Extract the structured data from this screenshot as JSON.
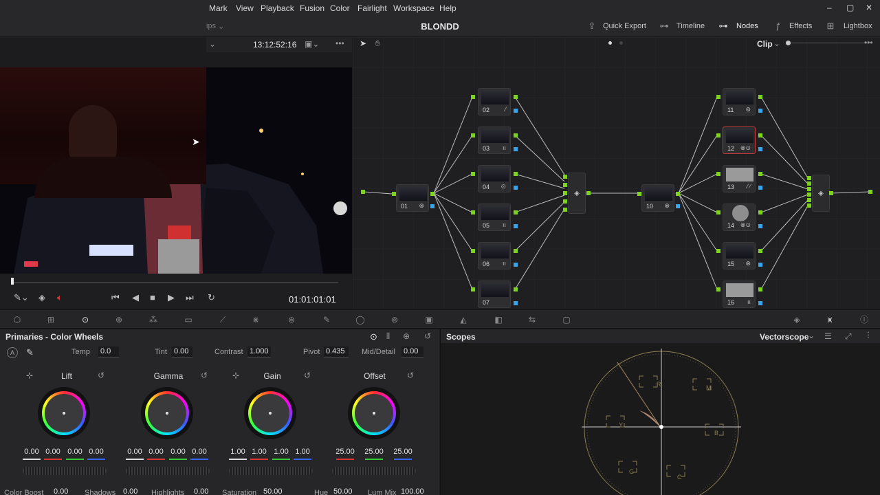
{
  "menu": {
    "items": [
      "Mark",
      "View",
      "Playback",
      "Fusion",
      "Color",
      "Fairlight",
      "Workspace",
      "Help"
    ]
  },
  "window": {
    "minimize": "–",
    "maximize": "▢",
    "close": "✕"
  },
  "toolbar": {
    "clips_partial": "ips",
    "project_title": "BLONDD",
    "quick_export": "Quick Export",
    "timeline": "Timeline",
    "nodes": "Nodes",
    "effects": "Effects",
    "lightbox": "Lightbox"
  },
  "viewer": {
    "timecode_top": "13:12:52:16",
    "timecode_bottom": "01:01:01:01"
  },
  "node_editor": {
    "mode": "Clip",
    "nodes": [
      {
        "label": "01",
        "icon": "⊗"
      },
      {
        "label": "02",
        "icon": "⁄"
      },
      {
        "label": "03",
        "icon": "ıı"
      },
      {
        "label": "04",
        "icon": "⊙"
      },
      {
        "label": "05",
        "icon": "ıı"
      },
      {
        "label": "06",
        "icon": "ıı"
      },
      {
        "label": "07",
        "icon": ""
      },
      {
        "label": "10",
        "icon": "⊗"
      },
      {
        "label": "11",
        "icon": "⊚"
      },
      {
        "label": "12",
        "icon": "⊗⊙"
      },
      {
        "label": "13",
        "icon": "⁄ ⁄"
      },
      {
        "label": "14",
        "icon": "⊗⊙"
      },
      {
        "label": "15",
        "icon": "⊗"
      },
      {
        "label": "16",
        "icon": "ıı"
      }
    ]
  },
  "primaries": {
    "title": "Primaries - Color Wheels",
    "temp_label": "Temp",
    "temp": "0.0",
    "tint_label": "Tint",
    "tint": "0.00",
    "contrast_label": "Contrast",
    "contrast": "1.000",
    "pivot_label": "Pivot",
    "pivot": "0.435",
    "middetail_label": "Mid/Detail",
    "middetail": "0.00",
    "wheels": [
      {
        "name": "Lift",
        "values": [
          "0.00",
          "0.00",
          "0.00",
          "0.00"
        ]
      },
      {
        "name": "Gamma",
        "values": [
          "0.00",
          "0.00",
          "0.00",
          "0.00"
        ]
      },
      {
        "name": "Gain",
        "values": [
          "1.00",
          "1.00",
          "1.00",
          "1.00"
        ]
      },
      {
        "name": "Offset",
        "values": [
          "25.00",
          "25.00",
          "25.00"
        ]
      }
    ],
    "bottom": {
      "color_boost_label": "Color Boost",
      "color_boost": "0.00",
      "shadows_label": "Shadows",
      "shadows": "0.00",
      "highlights_label": "Highlights",
      "highlights": "0.00",
      "saturation_label": "Saturation",
      "saturation": "50.00",
      "hue_label": "Hue",
      "hue": "50.00",
      "lum_mix_label": "Lum Mix",
      "lum_mix": "100.00"
    }
  },
  "scopes": {
    "title": "Scopes",
    "type": "Vectorscope",
    "targets": {
      "r": "R",
      "mg": "M",
      "b": "B",
      "cy": "C",
      "g": "G",
      "yl": "Y"
    }
  },
  "colors": {
    "node_green": "#7ed321",
    "node_blue": "#3ba3e8",
    "selected": "#c53a3a",
    "accent": "#e0e0e0"
  }
}
